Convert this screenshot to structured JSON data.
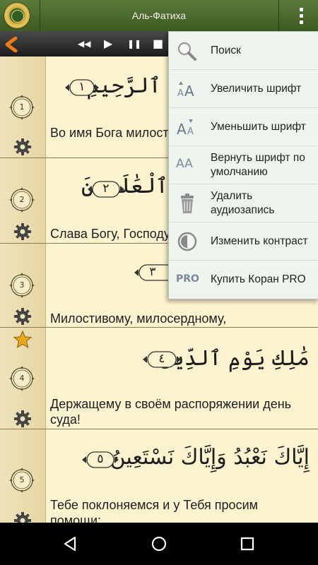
{
  "app": {
    "title": "Аль-Фатиха"
  },
  "player": {
    "rewind": "◀◀",
    "play": "▶",
    "pause": "❚❚",
    "stop": "■"
  },
  "verses": [
    {
      "number": "1",
      "marker": "١",
      "arabic": "ٱلرَّحِيمِ",
      "translation": "Во имя Бога милостивого, милосердного."
    },
    {
      "number": "2",
      "marker": "٢",
      "arabic": "ٱلْعَٰلَمِينَ",
      "translation": "Слава Богу, Господу миров,"
    },
    {
      "number": "3",
      "marker": "٣",
      "arabic": "",
      "translation": "Милостивому, милосердному,"
    },
    {
      "number": "4",
      "marker": "٤",
      "arabic": "مَٰلِكِ يَوْمِ ٱلدِّينِ",
      "translation": "Держащему в своём распоряжении день суда!"
    },
    {
      "number": "5",
      "marker": "٥",
      "arabic": "إِيَّاكَ نَعْبُدُ وَإِيَّاكَ نَسْتَعِينُ",
      "translation": "Тебе поклоняемся и у Тебя просим помощи;"
    }
  ],
  "menu": {
    "items": [
      {
        "label": "Поиск",
        "icon": "search-icon"
      },
      {
        "label": "Увеличить шрифт",
        "icon": "font-increase-icon"
      },
      {
        "label": "Уменьшить шрифт",
        "icon": "font-decrease-icon"
      },
      {
        "label": "Вернуть шрифт по умолчанию",
        "icon": "font-reset-icon"
      },
      {
        "label": "Удалить аудиозапись",
        "icon": "trash-icon"
      },
      {
        "label": "Изменить контраст",
        "icon": "contrast-icon"
      },
      {
        "label": "Купить Коран PRO",
        "icon": "pro-icon"
      }
    ],
    "pro_badge": "PRO",
    "font_glyph": "AA"
  },
  "colors": {
    "header": "#4e6e30",
    "page": "#fdf3cf",
    "menu_bg": "#eef5ee",
    "star": "#e8a91c"
  }
}
